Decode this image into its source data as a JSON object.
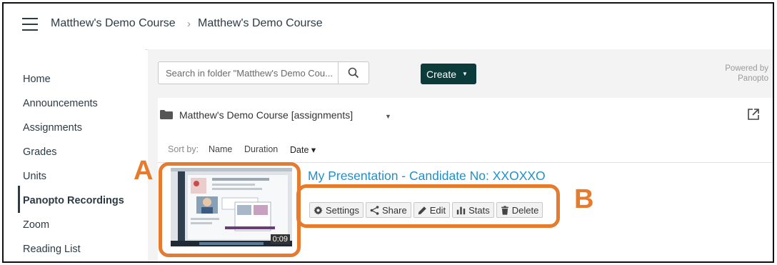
{
  "header": {
    "breadcrumb": [
      "Matthew's Demo Course",
      "Matthew's Demo Course"
    ],
    "separator": "›"
  },
  "sidebar": {
    "items": [
      {
        "label": "Home"
      },
      {
        "label": "Announcements"
      },
      {
        "label": "Assignments"
      },
      {
        "label": "Grades"
      },
      {
        "label": "Units"
      },
      {
        "label": "Panopto Recordings",
        "active": true
      },
      {
        "label": "Zoom"
      },
      {
        "label": "Reading List"
      }
    ]
  },
  "panopto": {
    "search_placeholder": "Search in folder \"Matthew's Demo Cou...",
    "create_label": "Create",
    "powered_by": [
      "Powered by",
      "Panopto"
    ],
    "folder_name": "Matthew's Demo Course [assignments]",
    "sort": {
      "label": "Sort by:",
      "options": [
        "Name",
        "Duration",
        "Date"
      ],
      "active": "Date",
      "direction_icon": "▾"
    },
    "session": {
      "title": "My Presentation - Candidate No: XXOXXO",
      "duration": "0:09",
      "actions": [
        "Settings",
        "Share",
        "Edit",
        "Stats",
        "Delete"
      ]
    }
  },
  "annotations": {
    "a": "A",
    "b": "B",
    "color": "#e77b2d"
  },
  "colors": {
    "create_button": "#0b3b3b",
    "title_link": "#1e90c9",
    "content_background": "#f3f3f3"
  }
}
